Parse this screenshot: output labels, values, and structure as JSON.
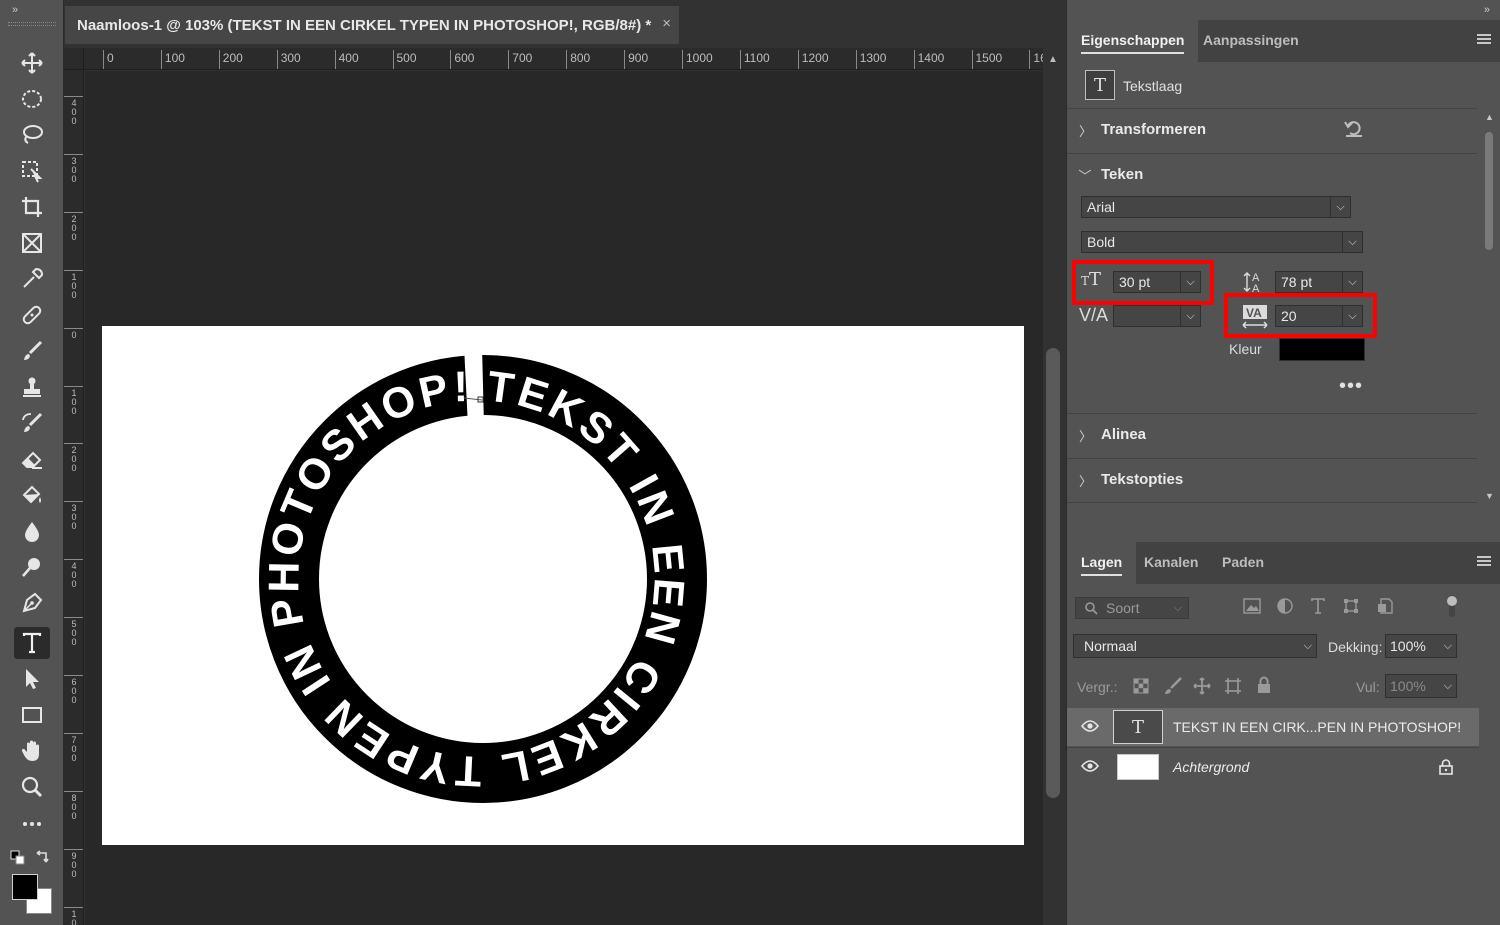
{
  "document": {
    "tab_title": "Naamloos-1 @ 103% (TEKST IN EEN CIRKEL TYPEN IN PHOTOSHOP!, RGB/8#) *",
    "close_glyph": "×",
    "ruler_h": [
      "0",
      "100",
      "200",
      "300",
      "400",
      "500",
      "600",
      "700",
      "800",
      "900",
      "1000",
      "1100",
      "1200",
      "1300",
      "1400",
      "1500",
      "16("
    ],
    "ruler_v": [
      "4\n0\n0",
      "3\n0\n0",
      "2\n0\n0",
      "1\n0\n0",
      "0",
      "1\n0\n0",
      "2\n0\n0",
      "3\n0\n0",
      "4\n0\n0",
      "5\n0\n0",
      "6\n0\n0",
      "7\n0\n0",
      "8\n0\n0",
      "9\n0\n0",
      "1\n0"
    ],
    "circle_text": "TEKST IN EEN CIRKEL TYPEN IN PHOTOSHOP!"
  },
  "toolbar": {
    "collapse_glyph": "»",
    "tools": [
      "move-icon",
      "elliptical-marquee-icon",
      "lasso-icon",
      "object-selection-icon",
      "crop-icon",
      "frame-icon",
      "eyedropper-icon",
      "healing-brush-icon",
      "brush-icon",
      "clone-stamp-icon",
      "history-brush-icon",
      "eraser-icon",
      "paint-bucket-icon",
      "blur-icon",
      "dodge-icon",
      "pen-icon",
      "type-icon",
      "path-selection-icon",
      "rectangle-icon",
      "hand-icon",
      "zoom-icon",
      "more-tools-icon"
    ],
    "active_tool": "type-icon",
    "foreground_color": "#000000",
    "background_color": "#ffffff"
  },
  "properties": {
    "collapse_glyph": "»",
    "tabs": [
      "Eigenschappen",
      "Aanpassingen"
    ],
    "layer_kind": "Tekstlaag",
    "sections": {
      "transform": "Transformeren",
      "character": "Teken",
      "paragraph": "Alinea",
      "text_options": "Tekstopties"
    },
    "font_family": "Arial",
    "font_style": "Bold",
    "font_size": "30 pt",
    "leading": "78 pt",
    "kerning": "",
    "tracking": "20",
    "color_label": "Kleur",
    "color_value": "#000000",
    "more_glyph": "•••",
    "highlight_color": "#ff0000"
  },
  "layers_panel": {
    "tabs": [
      "Lagen",
      "Kanalen",
      "Paden"
    ],
    "filter_placeholder": "Soort",
    "blend_mode": "Normaal",
    "opacity_label": "Dekking:",
    "opacity_value": "100%",
    "lock_label": "Vergr.:",
    "fill_label": "Vul:",
    "fill_value": "100%",
    "layers": [
      {
        "name": "TEKST IN EEN CIRK...PEN IN PHOTOSHOP!",
        "type": "text",
        "selected": true
      },
      {
        "name": "Achtergrond",
        "type": "background",
        "locked": true
      }
    ]
  }
}
